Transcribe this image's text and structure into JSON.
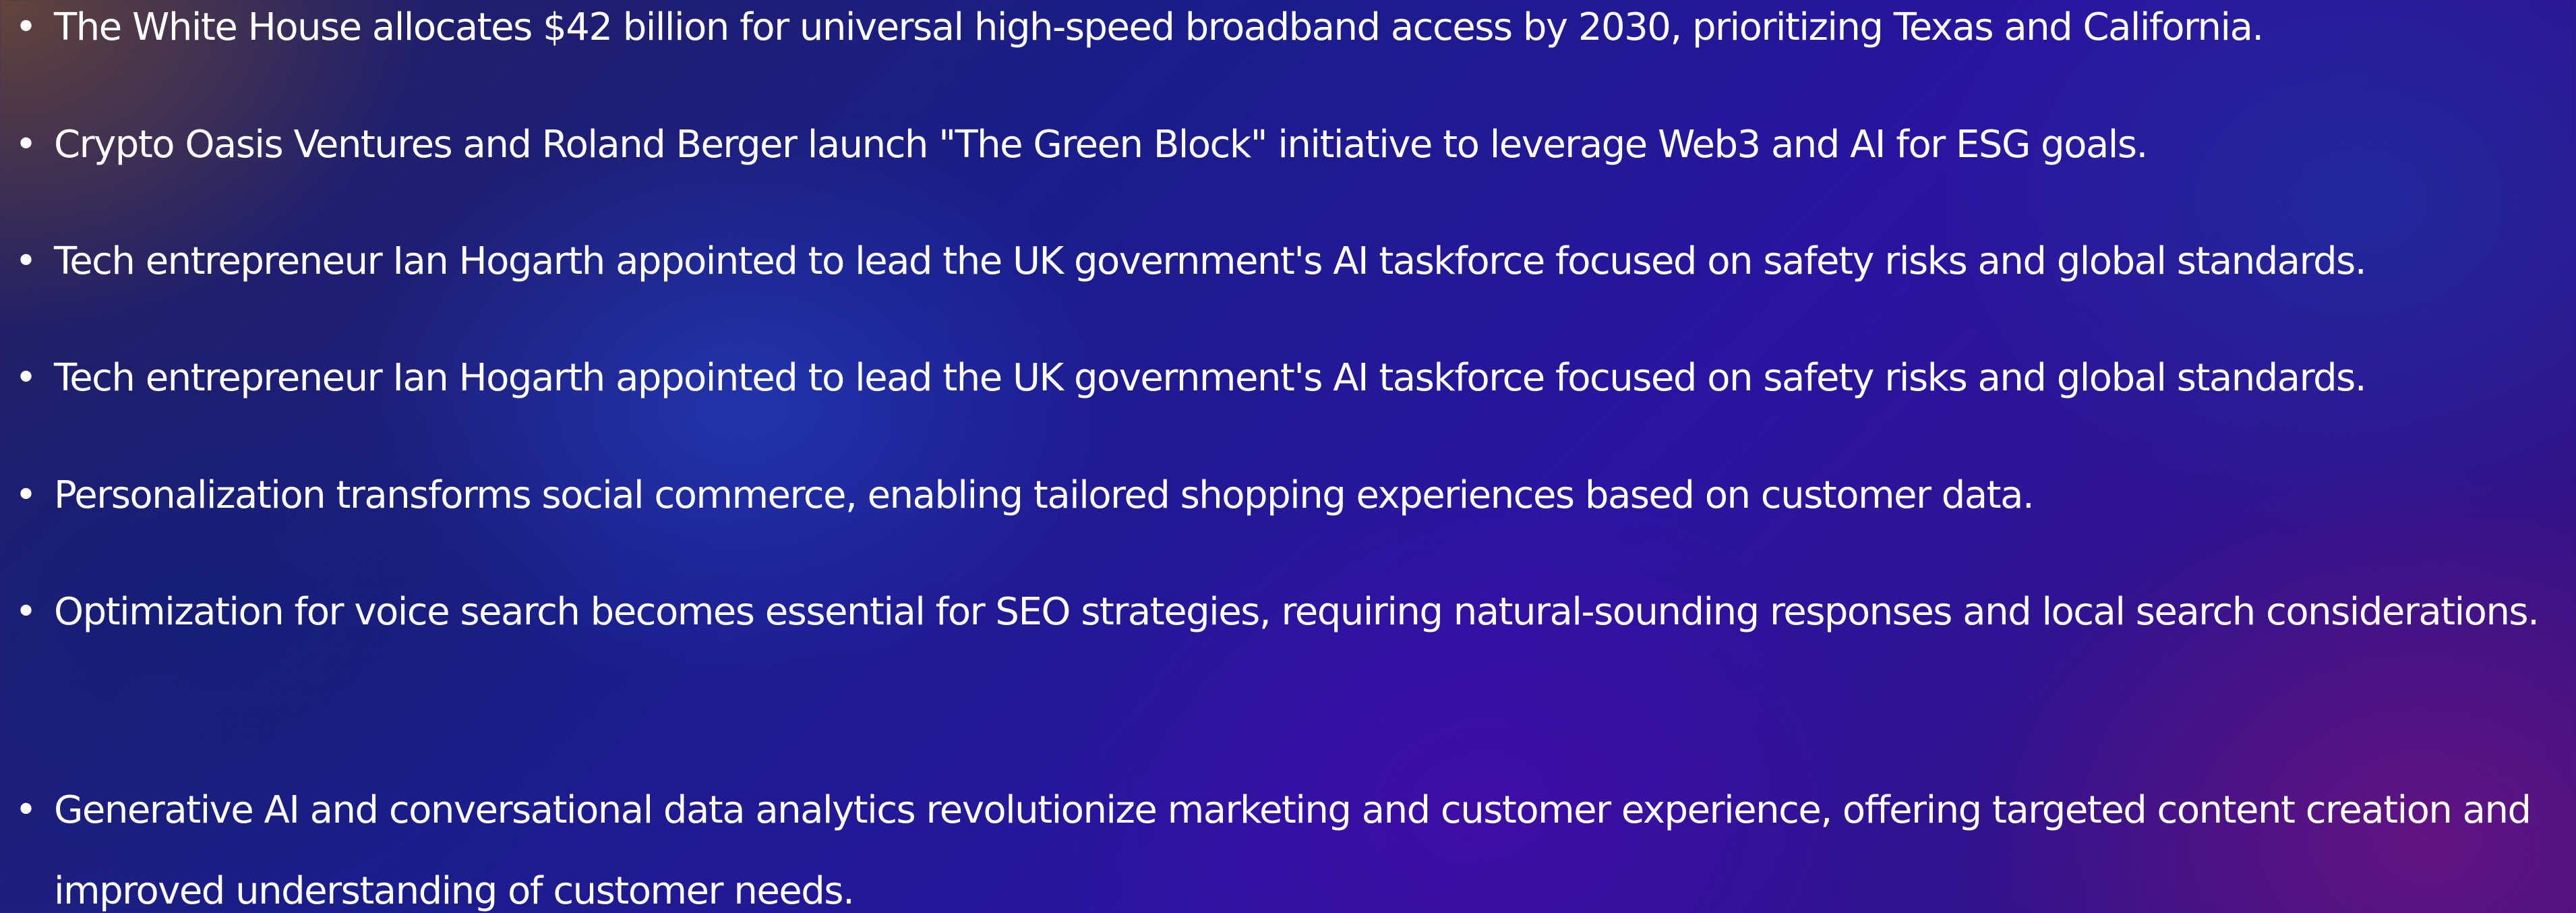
{
  "news_list": {
    "bullet": "•",
    "items": [
      {
        "text": "The White House allocates $42 billion for universal high-speed broadband access by 2030, prioritizing Texas and California."
      },
      {
        "text": "Crypto Oasis Ventures and Roland Berger launch \"The Green Block\" initiative to leverage Web3 and AI for ESG goals."
      },
      {
        "text": "Tech entrepreneur Ian Hogarth appointed to lead the UK government's AI taskforce focused on safety risks and global standards."
      },
      {
        "text": "Tech entrepreneur Ian Hogarth appointed to lead the UK government's AI taskforce focused on safety risks and global standards."
      },
      {
        "text": "Personalization transforms social commerce, enabling tailored shopping experiences based on customer data."
      },
      {
        "text": "Optimization for voice search becomes essential for SEO strategies, requiring natural-sounding responses and local search considerations."
      },
      {
        "text": "Generative AI and conversational data analytics revolutionize marketing and customer experience, offering targeted content creation and improved understanding of customer needs."
      }
    ]
  }
}
